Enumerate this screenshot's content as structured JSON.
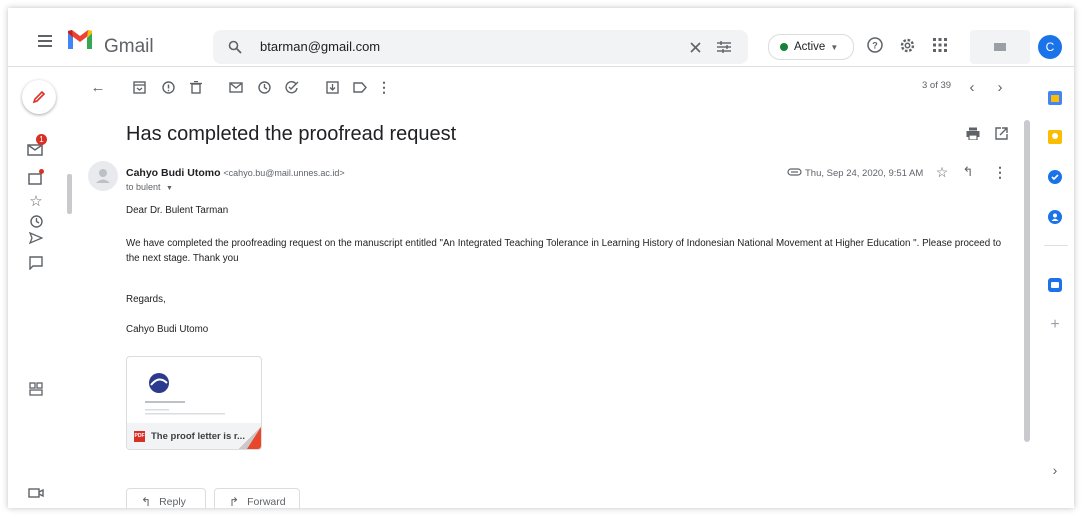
{
  "app": {
    "name": "Gmail"
  },
  "search": {
    "value": "btarman@gmail.com"
  },
  "status": {
    "label": "Active"
  },
  "account": {
    "initial": "C"
  },
  "pagination": {
    "label": "3 of 39"
  },
  "email": {
    "subject": "Has completed the proofread request",
    "sender_name": "Cahyo Budi Utomo",
    "sender_email": "<cahyo.bu@mail.unnes.ac.id>",
    "to_line": "to bulent",
    "date": "Thu, Sep 24, 2020, 9:51 AM",
    "greeting": "Dear Dr. Bulent Tarman",
    "body_line1": "We have completed the proofreading request on the manuscript entitled \"An Integrated Teaching Tolerance in Learning History of Indonesian National Movement at Higher Education \". Please proceed to",
    "body_line2": "the next stage. Thank you",
    "closing": "Regards,",
    "signature": "Cahyo Budi Utomo"
  },
  "attachment": {
    "name": "The proof letter is r...",
    "type_badge": "PDF"
  },
  "actions": {
    "reply": "Reply",
    "forward": "Forward"
  },
  "badges": {
    "mail_count": "1"
  },
  "colors": {
    "accent_red": "#d93025",
    "active_green": "#188038",
    "avatar_blue": "#1a73e8"
  }
}
